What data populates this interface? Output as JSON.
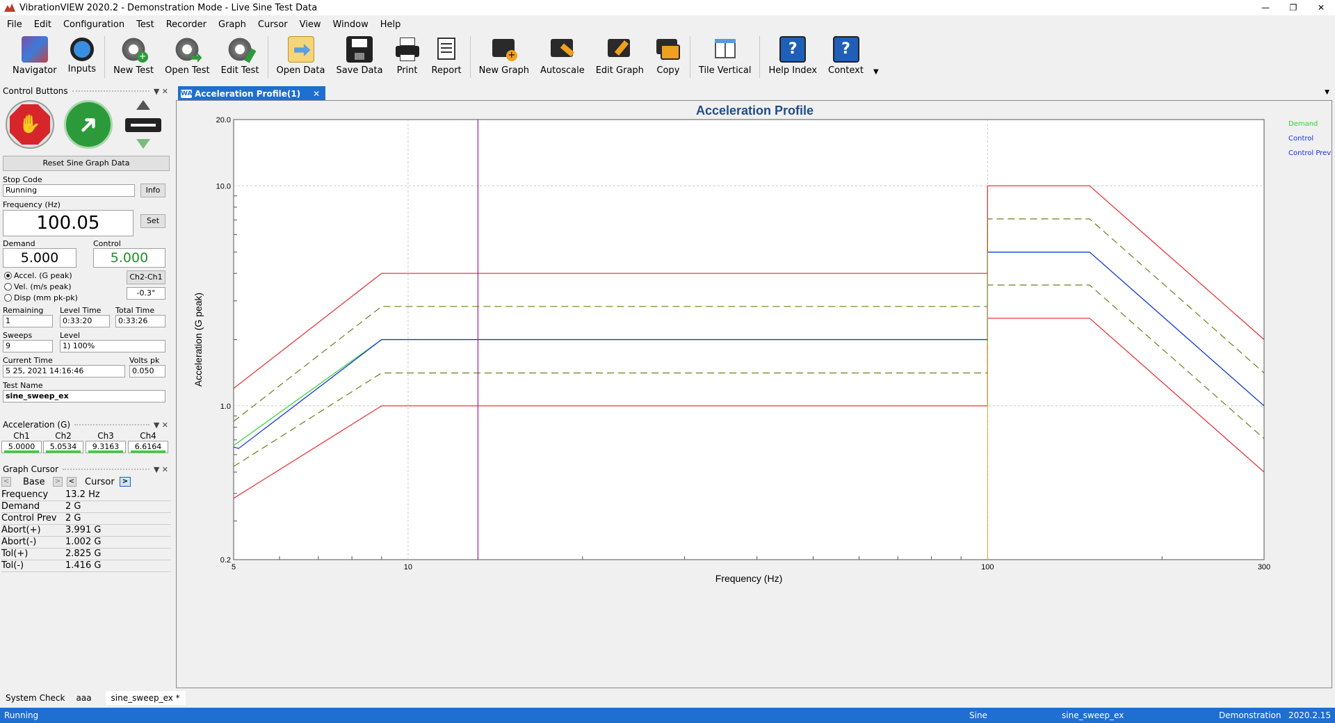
{
  "window": {
    "title": "VibrationVIEW 2020.2 - Demonstration Mode - Live Sine Test Data",
    "min": "—",
    "max": "❐",
    "close": "✕"
  },
  "menu": [
    "File",
    "Edit",
    "Configuration",
    "Test",
    "Recorder",
    "Graph",
    "Cursor",
    "View",
    "Window",
    "Help"
  ],
  "toolbar": {
    "navigator": "Navigator",
    "inputs": "Inputs",
    "new_test": "New Test",
    "open_test": "Open Test",
    "edit_test": "Edit Test",
    "open_data": "Open Data",
    "save_data": "Save Data",
    "print": "Print",
    "report": "Report",
    "new_graph": "New Graph",
    "autoscale": "Autoscale",
    "edit_graph": "Edit Graph",
    "copy": "Copy",
    "tile_vertical": "Tile Vertical",
    "help_index": "Help Index",
    "context": "Context"
  },
  "control_panel": {
    "header": "Control Buttons",
    "reset_label": "Reset Sine Graph Data",
    "stop_code_label": "Stop Code",
    "stop_code": "Running",
    "info_label": "Info",
    "frequency_label": "Frequency (Hz)",
    "frequency": "100.05",
    "set_label": "Set",
    "demand_label": "Demand",
    "demand": "5.000",
    "control_label": "Control",
    "control": "5.000",
    "radio_accel": "Accel. (G peak)",
    "radio_vel": "Vel. (m/s peak)",
    "radio_disp": "Disp (mm pk-pk)",
    "phase_btn": "Ch2-Ch1",
    "phase_val": "-0.3°",
    "remaining_label": "Remaining",
    "remaining": "1",
    "level_time_label": "Level Time",
    "level_time": "0:33:20",
    "total_time_label": "Total Time",
    "total_time": "0:33:26",
    "sweeps_label": "Sweeps",
    "sweeps": "9",
    "level_label": "Level",
    "level": "1) 100%",
    "current_time_label": "Current Time",
    "current_time": "5 25, 2021 14:16:46",
    "volts_label": "Volts pk",
    "volts": "0.050",
    "test_name_label": "Test Name",
    "test_name": "sine_sweep_ex"
  },
  "accel_panel": {
    "header": "Acceleration (G)",
    "channels": [
      {
        "name": "Ch1",
        "value": "5.0000"
      },
      {
        "name": "Ch2",
        "value": "5.0534"
      },
      {
        "name": "Ch3",
        "value": "9.3163"
      },
      {
        "name": "Ch4",
        "value": "6.6164"
      }
    ]
  },
  "cursor_panel": {
    "header": "Graph Cursor",
    "base_label": "Base",
    "cursor_label": "Cursor",
    "prev": "<",
    "next": ">",
    "rows": [
      {
        "k": "Frequency",
        "v": "13.2  Hz"
      },
      {
        "k": "Demand",
        "v": "2  G"
      },
      {
        "k": "Control Prev",
        "v": "2  G"
      },
      {
        "k": "Abort(+)",
        "v": "3.991  G"
      },
      {
        "k": "Abort(-)",
        "v": "1.002  G"
      },
      {
        "k": "Tol(+)",
        "v": "2.825  G"
      },
      {
        "k": "Tol(-)",
        "v": "1.416  G"
      }
    ]
  },
  "doc_tab": {
    "icon": "WA",
    "title": "Acceleration Profile(1)",
    "close": "✕"
  },
  "chart_data": {
    "type": "line",
    "title": "Acceleration Profile",
    "xlabel": "Frequency (Hz)",
    "ylabel": "Acceleration (G peak)",
    "xscale": "log",
    "yscale": "log",
    "xlim": [
      5,
      300
    ],
    "ylim": [
      0.2,
      20
    ],
    "x_ticks": [
      "5",
      "10",
      "100",
      "300"
    ],
    "y_ticks": [
      "20.0",
      "10.0",
      "1.0",
      "0.2"
    ],
    "grid": true,
    "legend": "top-right",
    "legend_entries": [
      "Demand",
      "Control",
      "Control Prev"
    ],
    "cursor_x": 13.2,
    "series": [
      {
        "key": "abort_hi",
        "color": "#e8262b",
        "dash": false,
        "points": [
          [
            5,
            1.2
          ],
          [
            9,
            4.0
          ],
          [
            100,
            4.0
          ],
          [
            100,
            10.0
          ],
          [
            150,
            10.0
          ],
          [
            300,
            2.0
          ]
        ]
      },
      {
        "key": "abort_lo",
        "color": "#e8262b",
        "dash": false,
        "points": [
          [
            5,
            0.38
          ],
          [
            9,
            1.0
          ],
          [
            100,
            1.0
          ],
          [
            100,
            2.5
          ],
          [
            150,
            2.5
          ],
          [
            300,
            0.5
          ]
        ]
      },
      {
        "key": "tol_hi",
        "color": "#6b7f1a",
        "dash": true,
        "points": [
          [
            5,
            0.85
          ],
          [
            9,
            2.83
          ],
          [
            100,
            2.83
          ],
          [
            100,
            7.07
          ],
          [
            150,
            7.07
          ],
          [
            300,
            1.41
          ]
        ]
      },
      {
        "key": "tol_lo",
        "color": "#6b7f1a",
        "dash": true,
        "points": [
          [
            5,
            0.53
          ],
          [
            9,
            1.41
          ],
          [
            100,
            1.41
          ],
          [
            100,
            3.54
          ],
          [
            150,
            3.54
          ],
          [
            300,
            0.71
          ]
        ]
      },
      {
        "name": "Demand",
        "color": "#2ed52e",
        "dash": false,
        "points": [
          [
            5,
            0.66
          ],
          [
            9,
            2.0
          ],
          [
            100,
            2.0
          ],
          [
            100,
            5.0
          ],
          [
            150,
            5.0
          ],
          [
            300,
            1.0
          ]
        ]
      },
      {
        "name": "Control",
        "color": "#1a2ee8",
        "dash": false,
        "points": [
          [
            5,
            0.65
          ],
          [
            5.1,
            0.64
          ],
          [
            9,
            2.0
          ],
          [
            100,
            2.0
          ],
          [
            100,
            5.0
          ],
          [
            150,
            5.0
          ],
          [
            300,
            1.0
          ]
        ]
      }
    ],
    "colors": {
      "cursor_line": "#a020a0",
      "step_line": "#c8b020"
    }
  },
  "bottom_tabs": [
    "System Check",
    "aaa",
    "sine_sweep_ex *"
  ],
  "status": {
    "left": "Running",
    "type": "Sine",
    "test": "sine_sweep_ex",
    "mode": "Demonstration",
    "version": "2020.2.15"
  }
}
